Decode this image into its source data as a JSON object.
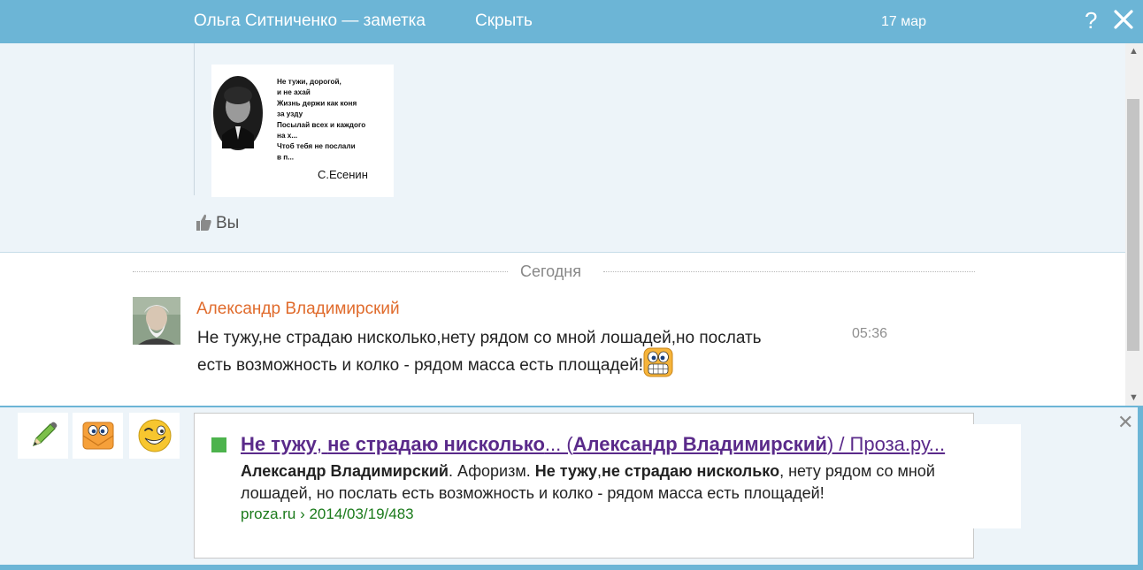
{
  "header": {
    "title": "Ольга Ситниченко — заметка",
    "hide_label": "Скрыть",
    "date": "17 мар",
    "help_label": "?"
  },
  "note": {
    "image": {
      "poem_lines": [
        "Не тужи, дорогой,",
        "и не ахай",
        "Жизнь держи как коня",
        "за узду",
        "Посылай всех и каждого",
        "на х...",
        "Чтоб тебя не послали",
        "в п..."
      ],
      "signature": "С.Есенин"
    },
    "like_label": "Вы"
  },
  "divider": {
    "label": "Сегодня"
  },
  "message": {
    "author": "Александр Владимирский",
    "text": "Не тужу,не страдаю нисколько,нету рядом со мной лошадей,но послать есть возможность и колко - рядом масса есть площадей!",
    "time": "05:36",
    "emoji": "grinning-emoji"
  },
  "toolbar": {
    "items": [
      {
        "name": "pencil-icon"
      },
      {
        "name": "smiley-envelope-icon"
      },
      {
        "name": "wink-smiley-icon"
      }
    ],
    "close_label": "✕"
  },
  "snippet": {
    "title_parts": [
      {
        "text": "Не тужу",
        "bold": true
      },
      {
        "text": ", ",
        "bold": false
      },
      {
        "text": "не страдаю нисколько",
        "bold": true
      },
      {
        "text": "... (",
        "bold": false
      },
      {
        "text": "Александр Владимирский",
        "bold": true
      },
      {
        "text": ") / Проза.ру...",
        "bold": false
      }
    ],
    "text_parts": [
      {
        "text": "Александр Владимирский",
        "bold": true
      },
      {
        "text": ". Афоризм. ",
        "bold": false
      },
      {
        "text": "Не тужу",
        "bold": true
      },
      {
        "text": ",",
        "bold": false
      },
      {
        "text": "не страдаю нисколько",
        "bold": true
      },
      {
        "text": ", нету рядом со мной лошадей, но послать есть возможность и колко - рядом масса есть площадей!",
        "bold": false
      }
    ],
    "url": "proza.ru › 2014/03/19/483"
  },
  "colors": {
    "header_bg": "#6cb5d6",
    "author_color": "#e06b2c",
    "link_color": "#5a2a8a",
    "url_color": "#1a7a1a"
  }
}
